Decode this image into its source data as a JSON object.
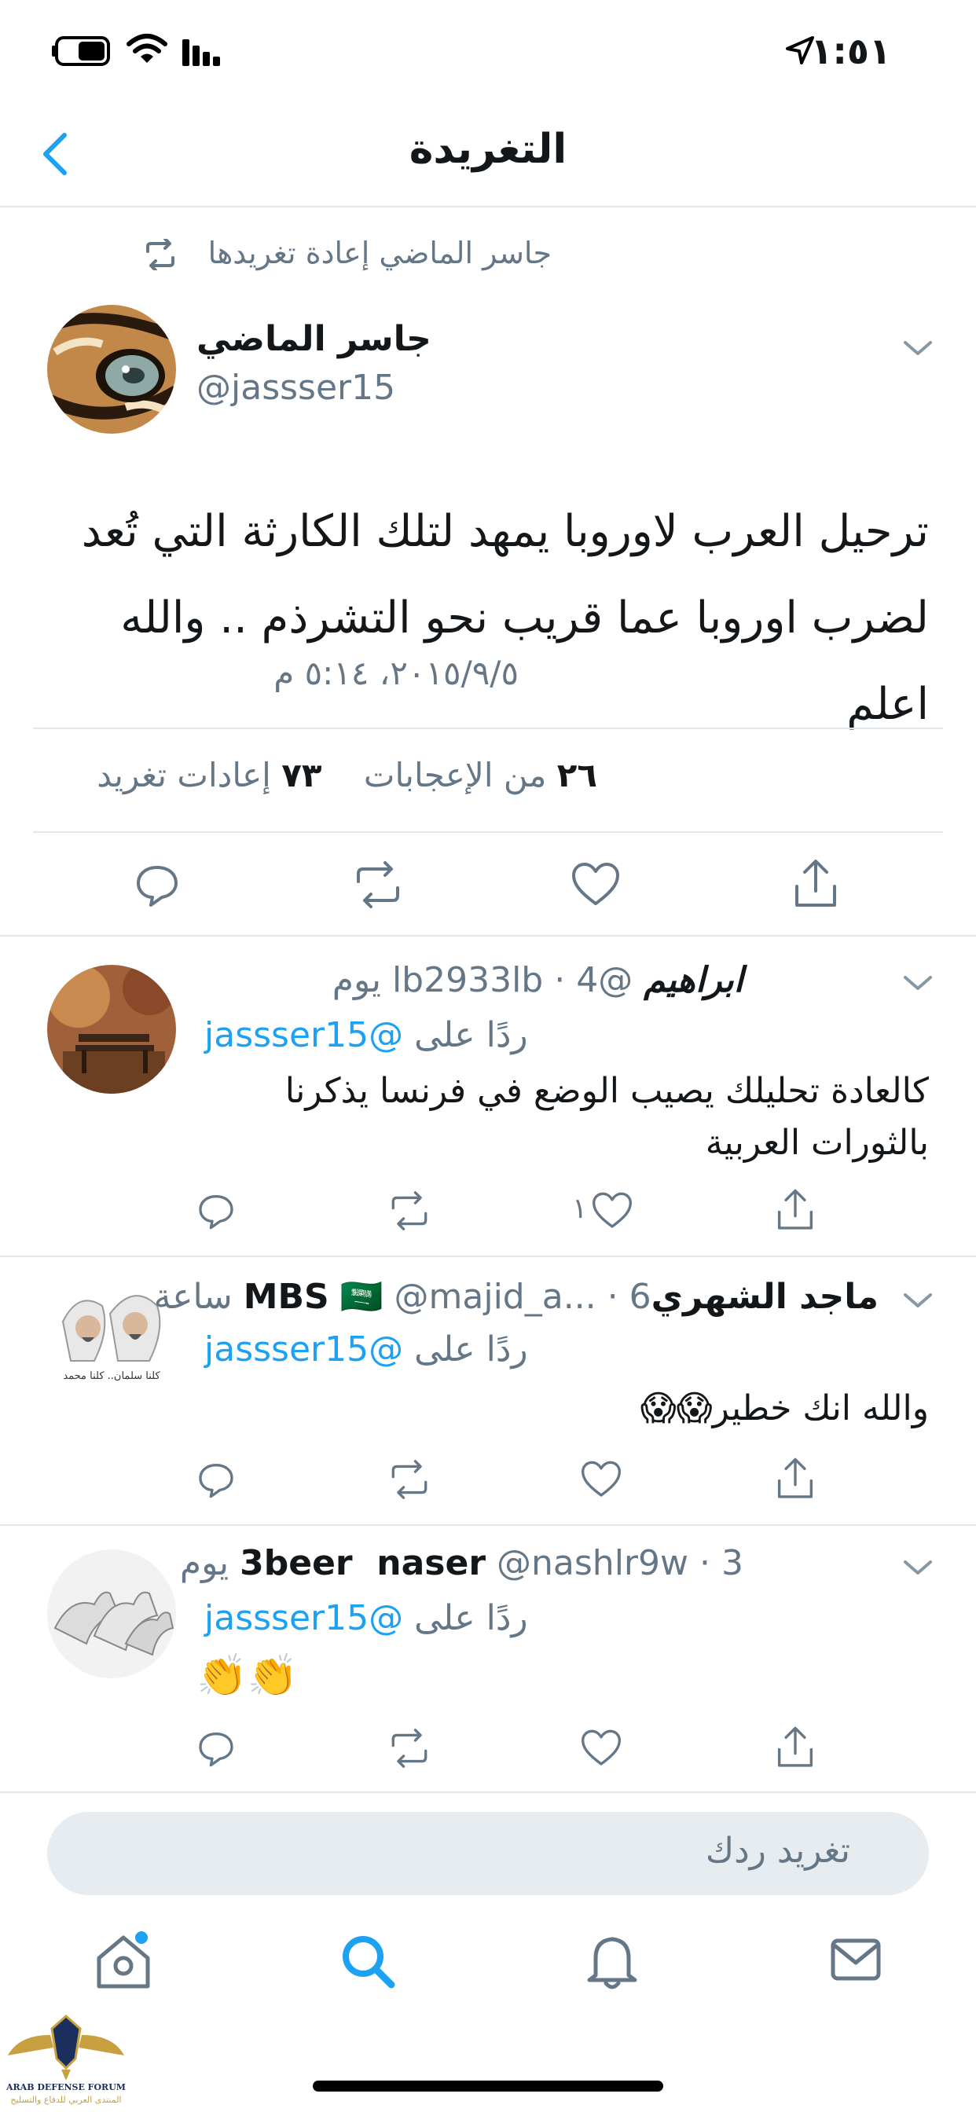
{
  "status_bar": {
    "time": "١:٥١"
  },
  "header": {
    "title": "التغريدة"
  },
  "main_tweet": {
    "retweet_context": "جاسر الماضي إعادة تغريدها",
    "author_name": "جاسر الماضي",
    "author_handle": "@jassser15",
    "text_line1": "ترحيل العرب لاوروبا يمهد لتلك الكارثة التي تُعد",
    "text_line2": "لضرب اوروبا عما قريب نحو التشرذم .. والله اعلم",
    "timestamp": "٢٠١٥/٩/٥، ٥:١٤ م",
    "likes_count": "٢٦",
    "likes_label": "من الإعجابات",
    "retweets_count": "٧٣",
    "retweets_label": "إعادات تغريد"
  },
  "replies": [
    {
      "author_name": "ابراهيم",
      "author_handle": "@lb2933lb",
      "time": "4 يوم",
      "replying_to_label": "ردًا على",
      "replying_to_handle": "@jassser15",
      "text_line1": "كالعادة تحليلك يصيب الوضع في فرنسا يذكرنا",
      "text_line2": "بالثورات العربية",
      "like_count": "١"
    },
    {
      "author_name": "ماجد الشهريMBS",
      "flag_emoji": "🇸🇦",
      "author_handle": "@majid_a...",
      "time": "6 ساعة",
      "replying_to_label": "ردًا على",
      "replying_to_handle": "@jassser15",
      "text_line1": "والله انك خطير😱😱",
      "avatar_caption": "كلنا سلمان.. كلنا محمد"
    },
    {
      "author_name": "3beer  naser",
      "author_handle": "@nashlr9w",
      "time": "3 يوم",
      "replying_to_label": "ردًا على",
      "replying_to_handle": "@jassser15",
      "text_line1": "👏👏"
    }
  ],
  "reply_composer": {
    "placeholder": "تغريد ردك"
  },
  "watermark": {
    "text_en": "ARAB DEFENSE FORUM",
    "text_ar": "المنتدى العربي للدفاع والتسليح"
  },
  "colors": {
    "accent": "#1da1f2",
    "secondary_text": "#657786",
    "separator": "#e1e8ed",
    "composer_bg": "#e6ecf0"
  }
}
